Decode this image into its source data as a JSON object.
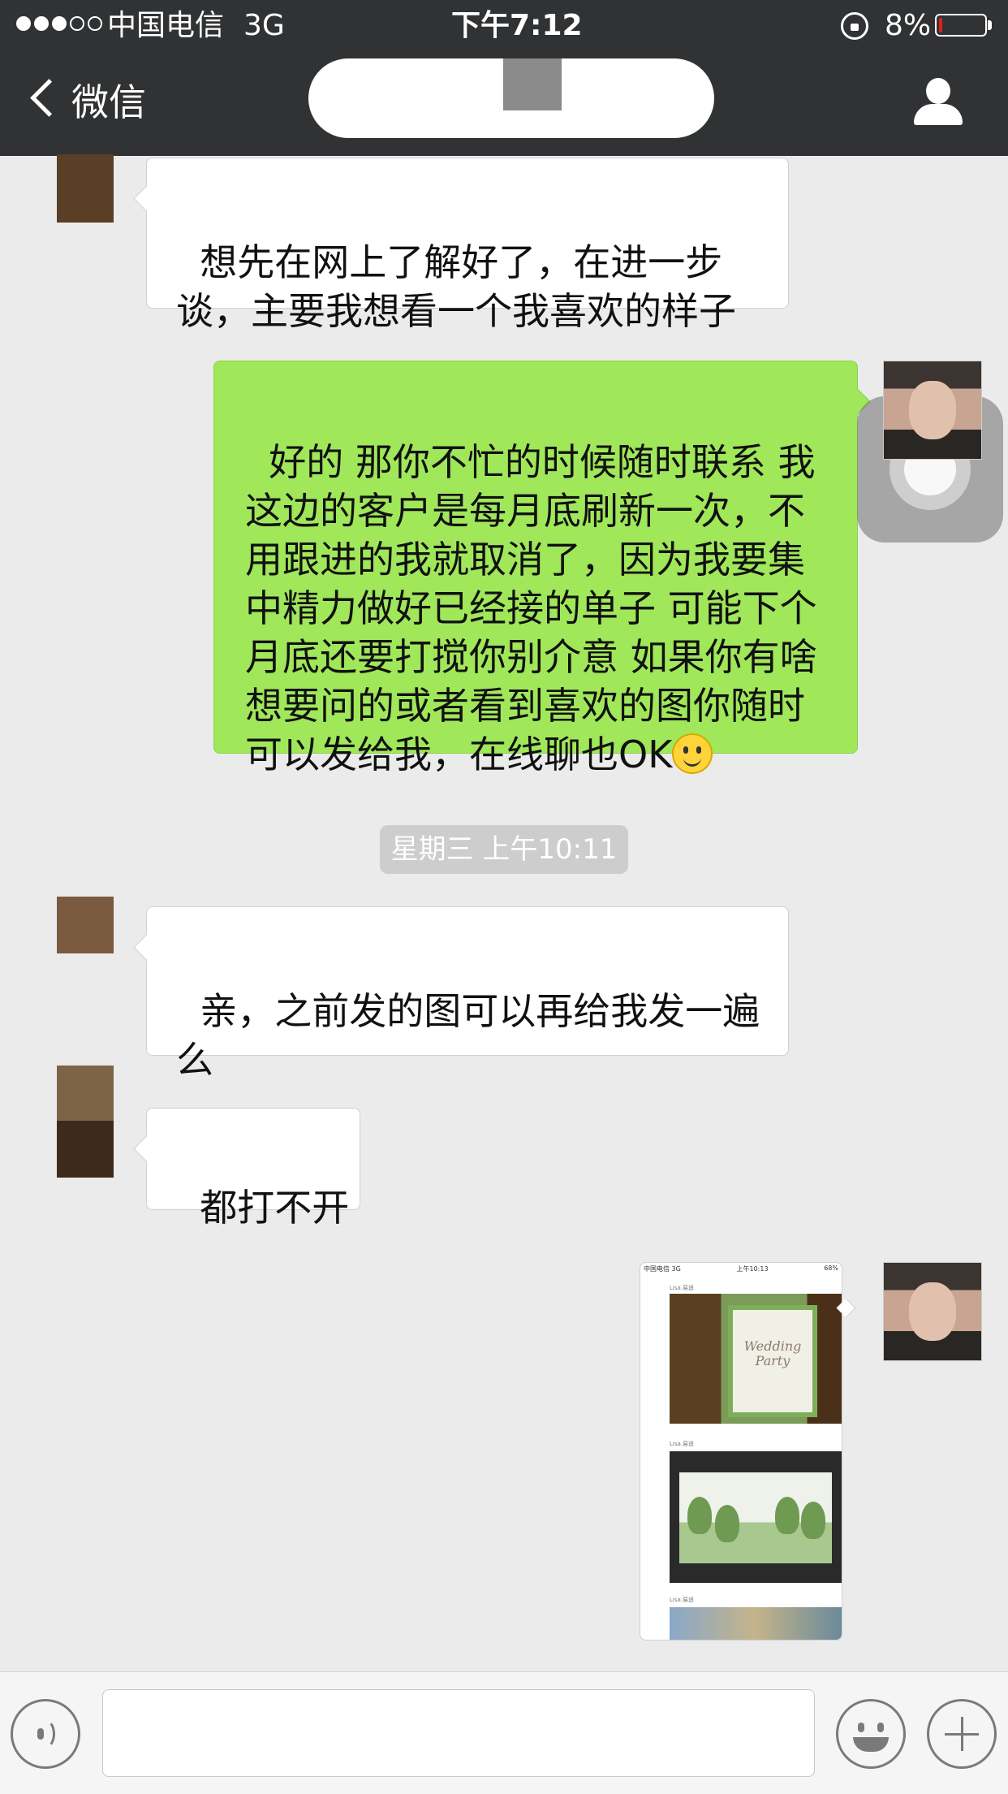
{
  "status_bar": {
    "carrier": "中国电信",
    "network": "3G",
    "time": "下午7:12",
    "battery": "8%",
    "battery_level": 0.08,
    "signal_bars": 3,
    "signal_total": 5
  },
  "nav": {
    "back_label": "微信",
    "title": ""
  },
  "messages": [
    {
      "side": "left",
      "text": "想先在网上了解好了，在进一步谈，主要我想看一个我喜欢的样子"
    },
    {
      "side": "right",
      "text": "好的 那你不忙的时候随时联系 我这边的客户是每月底刷新一次，不用跟进的我就取消了，因为我要集中精力做好已经接的单子 可能下个月底还要打搅你别介意 如果你有啥想要问的或者看到喜欢的图你随时可以发给我，在线聊也OK",
      "trailing_icon": "smile-emoji-icon"
    },
    {
      "type": "timestamp",
      "text": "星期三 上午10:11"
    },
    {
      "side": "left",
      "text": "亲，之前发的图可以再给我发一遍么"
    },
    {
      "side": "left",
      "text": "都打不开"
    },
    {
      "side": "right",
      "type": "image",
      "thumb": {
        "carrier": "中国电信",
        "network": "3G",
        "time": "上午10:13",
        "battery": "68%",
        "sender": "Lisa.易遥",
        "photo_text": "Wedding Party"
      }
    }
  ],
  "colors": {
    "nav_bg": "#303234",
    "chat_bg": "#ebebeb",
    "sent_bubble": "#a0e75a",
    "received_bubble": "#ffffff"
  },
  "input_bar": {
    "icons": [
      "voice-icon",
      "emoji-icon",
      "plus-icon"
    ],
    "value": ""
  }
}
